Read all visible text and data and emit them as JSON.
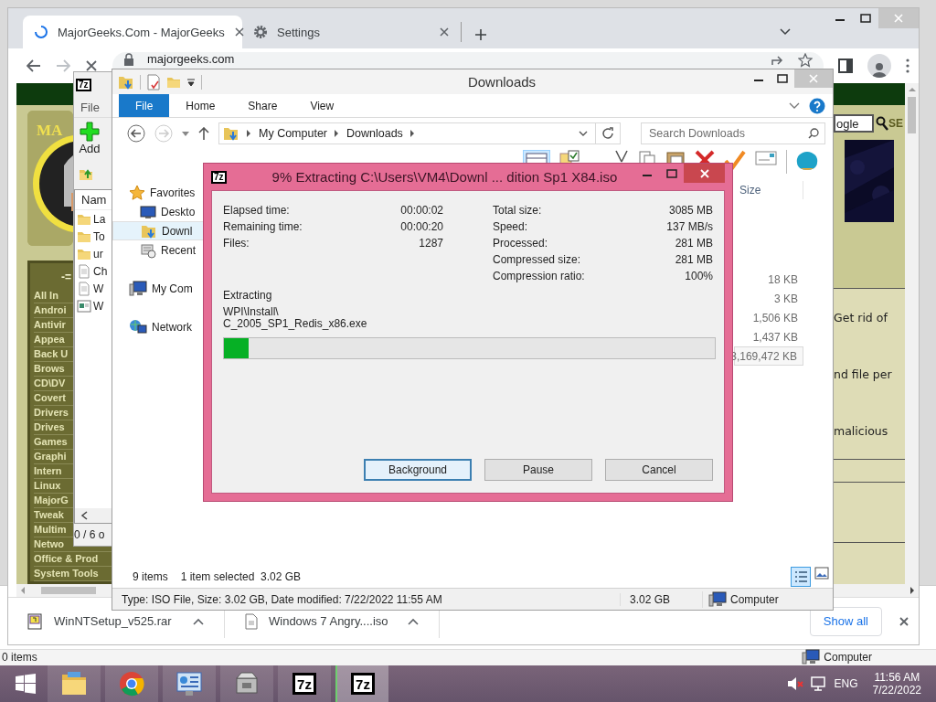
{
  "desktop": {
    "status_left": "0 items",
    "status_right": "Computer"
  },
  "browser": {
    "tabs": [
      {
        "title": "MajorGeeks.Com - MajorGeeks",
        "kind": "loading",
        "selected": true
      },
      {
        "title": "Settings",
        "kind": "settings",
        "selected": false
      }
    ],
    "address": "majorgeeks.com",
    "page": {
      "logo_text": "MA",
      "menu_header": "-=",
      "menu": [
        "All In",
        "Androi",
        "Antivir",
        "Appea",
        "Back U",
        "Brows",
        "CD\\DV",
        "Covert",
        "Drivers",
        "Drives",
        "Games",
        "Graphi",
        "Intern",
        "Linux",
        "MajorG",
        "Tweak",
        "Multim",
        "Netwo",
        "Office & Prod",
        "System Tools"
      ],
      "search_value": "ogle",
      "search_button": "SE",
      "snippets": [
        "Get rid of",
        "nd file per",
        "malicious"
      ]
    },
    "downloads": [
      {
        "name": "WinNTSetup_v525.rar",
        "kind": "rar"
      },
      {
        "name": "Windows 7 Angry....iso",
        "kind": "iso"
      }
    ],
    "show_all": "Show all"
  },
  "archiver": {
    "logo": "7z",
    "menu": [
      "File"
    ],
    "add": "Add",
    "column": "Nam",
    "rows": [
      {
        "name": "La",
        "kind": "folder"
      },
      {
        "name": "To",
        "kind": "folder"
      },
      {
        "name": "ur",
        "kind": "folder"
      },
      {
        "name": "Ch",
        "kind": "document"
      },
      {
        "name": "W",
        "kind": "document"
      },
      {
        "name": "W",
        "kind": "program"
      }
    ],
    "status": "0 / 6 o"
  },
  "explorer": {
    "title": "Downloads",
    "ribbon_tabs": [
      {
        "label": "File",
        "selected": true
      },
      {
        "label": "Home",
        "selected": false
      },
      {
        "label": "Share",
        "selected": false
      },
      {
        "label": "View",
        "selected": false
      }
    ],
    "breadcrumb": [
      "My Computer",
      "Downloads"
    ],
    "search_placeholder": "Search Downloads",
    "nav": [
      {
        "label": "Favorites",
        "kind": "favorites",
        "selected": false
      },
      {
        "label": "Deskto",
        "kind": "desktop",
        "selected": false
      },
      {
        "label": "Downl",
        "kind": "downloads",
        "selected": true
      },
      {
        "label": "Recent",
        "kind": "recent",
        "selected": false
      },
      {
        "label": "My Com",
        "kind": "computer",
        "selected": false
      },
      {
        "label": "Network",
        "kind": "network",
        "selected": false
      }
    ],
    "size_header": "Size",
    "files": [
      {
        "size": "18 KB",
        "selected": false
      },
      {
        "size": "3 KB",
        "selected": false
      },
      {
        "size": "1,506 KB",
        "selected": false
      },
      {
        "size": "1,437 KB",
        "selected": false
      },
      {
        "size": "3,169,472 KB",
        "selected": true
      }
    ],
    "item_count": "9 items",
    "selection": "1 item selected  3.02 GB",
    "details": {
      "info": "Type: ISO File, Size: 3.02 GB, Date modified: 7/22/2022 11:55 AM",
      "size": "3.02 GB",
      "location": "Computer"
    }
  },
  "dialog": {
    "logo": "7z",
    "title": "9% Extracting C:\\Users\\VM4\\Downl ... dition Sp1 X84.iso",
    "left_stats": [
      {
        "label": "Elapsed time:",
        "value": "00:00:02"
      },
      {
        "label": "Remaining time:",
        "value": "00:00:20"
      },
      {
        "label": "Files:",
        "value": "1287"
      }
    ],
    "right_stats": [
      {
        "label": "Total size:",
        "value": "3085 MB"
      },
      {
        "label": "Speed:",
        "value": "137 MB/s"
      },
      {
        "label": "Processed:",
        "value": "281 MB"
      },
      {
        "label": "Compressed size:",
        "value": "281 MB"
      },
      {
        "label": "Compression ratio:",
        "value": "100%"
      }
    ],
    "operation": "Extracting",
    "path": [
      "WPI\\Install\\",
      "C_2005_SP1_Redis_x86.exe"
    ],
    "progress": {
      "level": 0.05
    },
    "buttons": [
      {
        "label": "Background",
        "default": true
      },
      {
        "label": "Pause",
        "default": false
      },
      {
        "label": "Cancel",
        "default": false
      }
    ]
  },
  "taskbar": {
    "apps": [
      {
        "kind": "explorer",
        "active": false
      },
      {
        "kind": "chrome",
        "active": false
      },
      {
        "kind": "control",
        "active": false
      },
      {
        "kind": "installer",
        "active": false
      },
      {
        "kind": "archiver",
        "label": "7z",
        "active": false
      },
      {
        "kind": "archiver",
        "label": "7z",
        "active": true
      }
    ],
    "language": "ENG",
    "time": "11:56 AM",
    "date": "7/22/2022"
  }
}
